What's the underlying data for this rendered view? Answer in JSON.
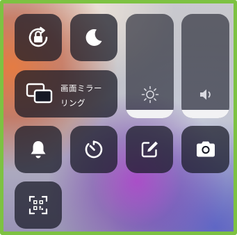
{
  "control_center": {
    "tiles": {
      "orientation_lock": {
        "icon": "orientation-lock-icon"
      },
      "do_not_disturb": {
        "icon": "moon-icon"
      },
      "screen_mirroring": {
        "icon": "screen-mirroring-icon",
        "label": "画面ミラーリング"
      },
      "ringer": {
        "icon": "bell-icon"
      },
      "timer": {
        "icon": "timer-icon"
      },
      "notes": {
        "icon": "note-pencil-icon"
      },
      "camera": {
        "icon": "camera-icon"
      },
      "qr_scanner": {
        "icon": "qr-code-icon"
      }
    },
    "sliders": {
      "brightness": {
        "icon": "sun-icon",
        "level": 0.08
      },
      "volume": {
        "icon": "speaker-icon",
        "level": 0.08
      }
    }
  },
  "colors": {
    "border": "#7dc242",
    "tile_background": "rgba(22,24,36,0.72)",
    "slider_fill": "#f2f2f4",
    "glyph": "#ffffff"
  }
}
